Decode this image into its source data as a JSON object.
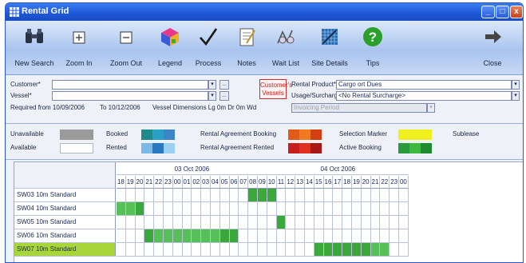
{
  "window": {
    "title": "Rental Grid",
    "controls": {
      "minimize": "_",
      "maximize": "□",
      "close": "x"
    }
  },
  "toolbar": {
    "buttons": [
      {
        "label": "New Search",
        "icon": "binoculars-icon"
      },
      {
        "label": "Zoom In",
        "icon": "zoom-in-icon"
      },
      {
        "label": "Zoom Out",
        "icon": "zoom-out-icon"
      },
      {
        "label": "Legend",
        "icon": "legend-cube-icon"
      },
      {
        "label": "Process",
        "icon": "checkmark-icon"
      },
      {
        "label": "Notes",
        "icon": "notes-icon"
      },
      {
        "label": "Wait List",
        "icon": "wait-list-icon"
      },
      {
        "label": "Site Details",
        "icon": "site-details-icon"
      },
      {
        "label": "Tips",
        "icon": "help-icon"
      },
      {
        "label": "Close",
        "icon": "exit-arrow-icon"
      }
    ]
  },
  "form": {
    "customer_label": "Customer*",
    "customer_value": "",
    "vessel_label": "Vessel*",
    "vessel_value": "",
    "customers_vessels_button": "Customer's Vessels",
    "rental_product_label": "Rental Product*",
    "rental_product_value": "Cargo  ort Dues",
    "usage_label": "Usage/Surcharge*",
    "usage_value": "<No Rental Surcharge>",
    "required_from_label": "Required from 10/09/2006",
    "to_label": "To 10/12/2006",
    "vessel_dimensions_label": "Vessel Dimensions   Lg 0m  Dr 0m  Wd",
    "invoicing_period_label": "Invoicing Period",
    "dropdown_glyph": "▾",
    "ellipsis_glyph": "..."
  },
  "legend": {
    "unavailable": "Unavailable",
    "available": "Available",
    "booked": "Booked",
    "rented": "Rented",
    "rental_agreement_booking": "Rental Agreement Booking",
    "rental_agreement_rented": "Rental Agreement Rented",
    "selection_marker": "Selection Marker",
    "active_booking": "Active Booking",
    "sublease": "Sublease"
  },
  "grid": {
    "group1_label": "03 Oct 2006",
    "group2_label": "04 Oct 2006",
    "hours": [
      "18",
      "19",
      "20",
      "21",
      "22",
      "23",
      "00",
      "01",
      "02",
      "03",
      "04",
      "05",
      "06",
      "07",
      "08",
      "09",
      "10",
      "11",
      "12",
      "13",
      "14",
      "15",
      "16",
      "17",
      "18",
      "19",
      "20",
      "21",
      "22",
      "23",
      "00"
    ],
    "rows": [
      {
        "label": "SW03 10m Standard"
      },
      {
        "label": "SW04 10m Standard"
      },
      {
        "label": "SW05 10m Standard"
      },
      {
        "label": "SW06 10m Standard"
      },
      {
        "label": "SW07 10m Standard"
      }
    ]
  },
  "colors": {
    "active_booking": "#3aa83a",
    "active_booking_light": "#58c058",
    "selection": "#a6d63a",
    "unavailable": "#9a9a9a",
    "booked": "#2a9aa0",
    "rented": "#3c86c8",
    "agreement_booking": "#e05a18",
    "agreement_rented": "#c81e1e",
    "selection_marker": "#f0f020",
    "title_bar": "#1e57d8"
  }
}
